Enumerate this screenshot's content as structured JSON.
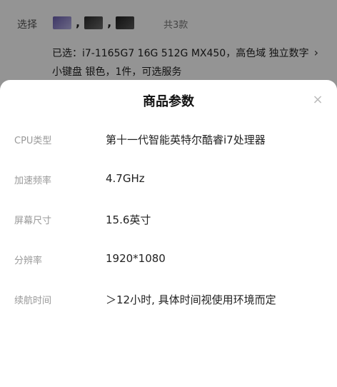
{
  "background": {
    "select_label": "选择",
    "separator": ",",
    "count_text": "共3款",
    "selected_summary": "已选：i7-1165G7 16G 512G MX450，高色域 独立数字小键盘 银色，1件，可选服务",
    "chevron": "›"
  },
  "sheet": {
    "title": "商品参数",
    "close_glyph": "×",
    "params": [
      {
        "label": "CPU类型",
        "value": "第十一代智能英特尔酷睿i7处理器"
      },
      {
        "label": "加速频率",
        "value": "4.7GHz"
      },
      {
        "label": "屏幕尺寸",
        "value": "15.6英寸"
      },
      {
        "label": "分辨率",
        "value": "1920*1080"
      },
      {
        "label": "续航时间",
        "value": "＞12小时, 具体时间视使用环境而定"
      }
    ]
  }
}
